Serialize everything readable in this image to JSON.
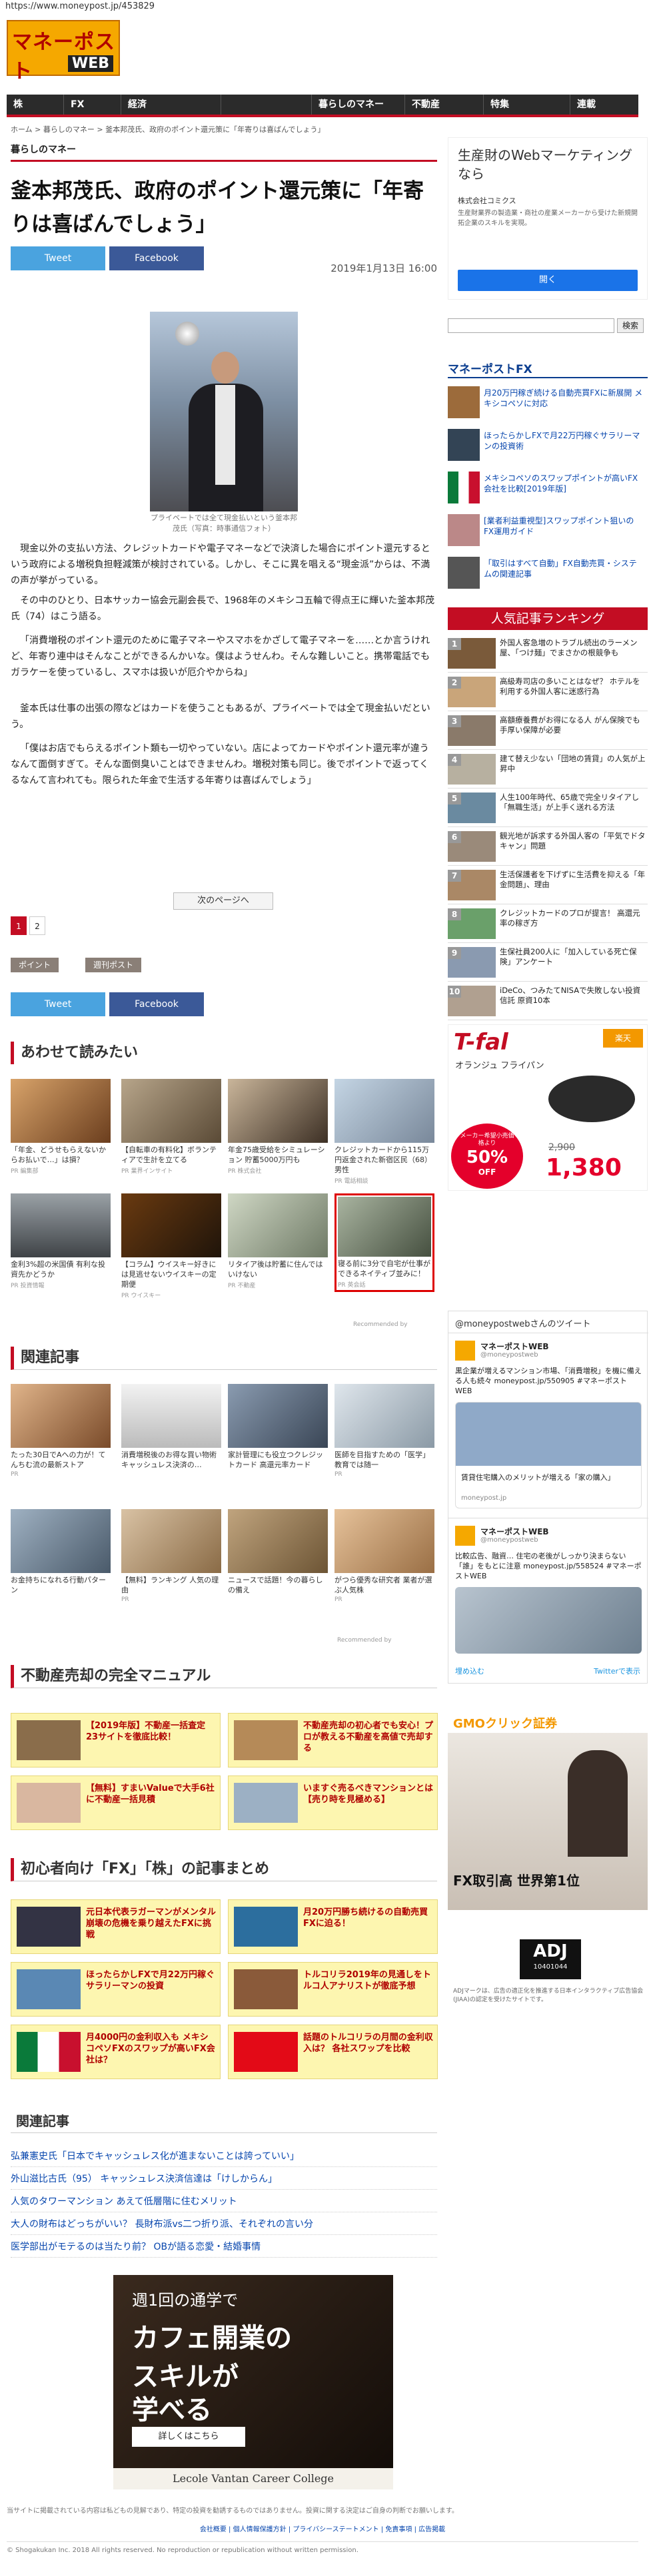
{
  "url": "https://www.moneypost.jp/453829",
  "logo": {
    "line1": "マネーポスト",
    "line2": "WEB"
  },
  "nav": [
    "株",
    "FX",
    "経済",
    "",
    "暮らしのマネー",
    "不動産",
    "特集",
    "連載"
  ],
  "crumb": "ホーム > 暮らしのマネー > 釜本邦茂氏、政府のポイント還元策に「年寄りは喜ばんでしょう」",
  "section": "暮らしのマネー",
  "title": "釜本邦茂氏、政府のポイント還元策に「年寄りは喜ばんでしょう」",
  "tweet": "Tweet",
  "facebook": "Facebook",
  "date": "2019年1月13日 16:00",
  "caption": "プライベートでは全て現金払いという釜本邦茂氏（写真：時事通信フォト）",
  "paras": [
    "現金以外の支払い方法、クレジットカードや電子マネーなどで決済した場合にポイント還元するという政府による増税負担軽減策が検討されている。しかし、そこに異を唱える“現金派”からは、不満の声が挙がっている。",
    "その中のひとり、日本サッカー協会元副会長で、1968年のメキシコ五輪で得点王に輝いた釜本邦茂氏（74）はこう語る。",
    "「消費増税のポイント還元のために電子マネーやスマホをかざして電子マネーを……とか言うけれど、年寄り連中はそんなことができるんかいな。僕はようせんわ。そんな難しいこと。携帯電話でもガラケーを使っているし、スマホは扱いが厄介やからね」",
    "釜本氏は仕事の出張の際などはカードを使うこともあるが、プライベートでは全て現金払いだという。",
    "「僕はお店でもらえるポイント類も一切やっていない。店によってカードやポイント還元率が違うなんて面倒すぎて。そんな面倒臭いことはできませんわ。増税対策も同じ。後でポイントで返ってくるなんて言われても。限られた年金で生活する年寄りは喜ばんでしょう」"
  ],
  "next_page": "次のページへ",
  "pages": [
    "1",
    "2"
  ],
  "tags": [
    "ポイント",
    "週刊ポスト"
  ],
  "sections": {
    "related_read": "あわせて読みたい",
    "related": "関連記事",
    "realestate": "不動産売却の完全マニュアル",
    "beginner": "初心者向け「FX」「株」の記事まとめ",
    "related2": "関連記事"
  },
  "read_cards": [
    {
      "t": "「年金、どうせもらえないからお払いで…」は損？",
      "s": "PR 編集部"
    },
    {
      "t": "【自転車の有料化】ボランティアで生計を立てる",
      "s": "PR 業界インサイト"
    },
    {
      "t": "年金75歳受給をシミュレーション 貯蓄5000万円も",
      "s": "PR 株式会社"
    },
    {
      "t": "クレジットカードから115万円返金された新宿区民（68）男性",
      "s": "PR 電話相談"
    },
    {
      "t": "金利3%超の米国債 有利な投資先かどうか",
      "s": "PR 投資情報"
    },
    {
      "t": "【コラム】ウイスキー好きには見逃せないウイスキーの定期便",
      "s": "PR ウイスキー"
    },
    {
      "t": "リタイア後は貯蓄に住んではいけない",
      "s": "PR 不動産"
    },
    {
      "t": "寝る前に3分で自宅が仕事ができるネイティブ並みに！",
      "s": "PR 英会話"
    }
  ],
  "recommended": "Recommended by",
  "rel_cards": [
    {
      "t": "たった30日でAへの力が！てんちむ流の最新ストア",
      "s": "PR"
    },
    {
      "t": "消費増税後のお得な買い物術 キャッシュレス決済の…",
      "s": ""
    },
    {
      "t": "家計管理にも役立つクレジットカード 高還元率カード",
      "s": ""
    },
    {
      "t": "医師を目指すための「医学」教育では随一",
      "s": "PR"
    },
    {
      "t": "お金持ちになれる行動パターン",
      "s": ""
    },
    {
      "t": "【無料】ランキング 人気の理由",
      "s": "PR"
    },
    {
      "t": "ニュースで話題！今の暮らしの備え",
      "s": ""
    },
    {
      "t": "がつら優秀な研究者 業者が選ぶ人気株",
      "s": "PR"
    }
  ],
  "manuals": [
    "【2019年版】不動産一括査定23サイトを徹底比較！",
    "不動産売却の初心者でも安心！プロが教える不動産を高値で売却する",
    "【無料】すまいValueで大手6社に不動産一括見積",
    "いますぐ売るべきマンションとは【売り時を見極める】"
  ],
  "beginner": [
    "元日本代表ラガーマンがメンタル崩壊の危機を乗り越えたFXに挑戦",
    "月20万円勝ち続けるの自動売買FXに迫る！",
    "ほったらかしFXで月22万円稼ぐサラリーマンの投資",
    "トルコリラ2019年の見通しをトルコ人アナリストが徹底予想",
    "月4000円の金利収入も メキシコペソFXのスワップが高いFX会社は？",
    "話題のトルコリラの月間の金利収入は？ 各社スワップを比較"
  ],
  "related_links": [
    "弘兼憲史氏「日本でキャッシュレス化が進まないことは誇っていい」",
    "外山滋比古氏（95） キャッシュレス決済信達は「けしからん」",
    "人気のタワーマンション あえて低層階に住むメリット",
    "大人の財布はどっちがいい？ 長財布派vs二つ折り派、それぞれの言い分",
    "医学部出がモテるのは当たり前？ OBが語る恋愛・結婚事情"
  ],
  "bottom_ad": {
    "l1": "週1回の通学で",
    "l2": "カフェ開業の",
    "l3": "スキルが",
    "l4": "学べる",
    "btn": "詳しくはこちら",
    "school": "Lecole Vantan Career College"
  },
  "footer_note": "当サイトに掲載されている内容は私どもの見解であり、特定の投資を勧誘するものではありません。投資に関する決定はご自身の判断でお願いします。",
  "footer_links": [
    "会社概要",
    "個人情報保護方針",
    "プライバシーステートメント",
    "免責事項",
    "広告掲載"
  ],
  "copyright": "© Shogakukan Inc. 2018  All rights reserved. No reproduction or republication without written permission.",
  "side_ad": {
    "title": "生産財のWebマーケティングなら",
    "company": "株式会社コミクス",
    "desc": "生産財業界の製造業・商社の産業メーカーから受けた新規開拓企業のスキルを実現。",
    "btn": "開く"
  },
  "search_btn": "検索",
  "fx_head": "マネーポストFX",
  "fx_items": [
    "月20万円稼ぎ続ける自動売買FXに新展開 メキシコペソに対応",
    "ほったらかしFXで月22万円稼ぐサラリーマンの投資術",
    "メキシコペソのスワップポイントが高いFX会社を比較[2019年版]",
    "[業者利益重視型]スワップポイント狙いのFX運用ガイド",
    "「取引はすべて自動」FX自動売買・システムの関連記事"
  ],
  "rank_head": "人気記事ランキング",
  "ranking": [
    "外国人客急増のトラブル続出のラーメン屋、「つけ麺」でまさかの根競争も",
    "高級寿司店の多いことはなぜ？ ホテルを利用する外国人客に迷惑行為",
    "高額療養費がお得になる人 がん保険でも手厚い保障が必要",
    "建て替え少ない「団地の賃貸」の人気が上昇中",
    "人生100年時代、65歳で完全リタイアし「無職生活」が上手く送れる方法",
    "観光地が訴求する外国人客の「平気でドタキャン」問題",
    "生活保護者を下げずに生活費を抑える「年金問題」、理由",
    "クレジットカードのプロが提言！ 高還元率の稼ぎ方",
    "生保社員200人に「加入している死亡保険」アンケート",
    "iDeCo、つみたてNISAで失敗しない投資信託 原資10本"
  ],
  "tfal": {
    "brand": "T-fal",
    "product": "オランジュ フライパン",
    "shop": "楽天",
    "price": "1,380",
    "orig": "2,900",
    "note": "メーカー希望小売価格より",
    "pct": "50%",
    "off": "OFF"
  },
  "twitter": {
    "label": "@moneypostwebさんのツイート",
    "name": "マネーポストWEB",
    "handle": "@moneypostweb",
    "tweet1": "黒企業が増えるマンション市場、「消費増税」を機に備える人も続々 moneypost.jp/550905 #マネーポストWEB",
    "tweet2": "比較広告、融資… 住宅の老後がしっかり決まらない「誰」をもとに注意 moneypost.jp/558524 #マネーポストWEB",
    "card": "賃貸住宅購入のメリットが増える「家の購入」",
    "domain": "moneypost.jp",
    "embed": "埋め込む",
    "view": "Twitterで表示"
  },
  "gmo": {
    "brand": "GMOクリック証券",
    "text": "FX取引高 世界第1位"
  },
  "adj": {
    "mark": "ADJ",
    "num": "10401044",
    "desc": "ADJマークは、広告の適正化を推進する日本インタラクティブ広告協会(JIAA)の認定を受けたサイトです。"
  },
  "colors": {
    "accent": "#c30d23",
    "nav": "#2b2b2b",
    "logo": "#f5a800",
    "tweet": "#4aa3df",
    "fb": "#3b5998"
  }
}
